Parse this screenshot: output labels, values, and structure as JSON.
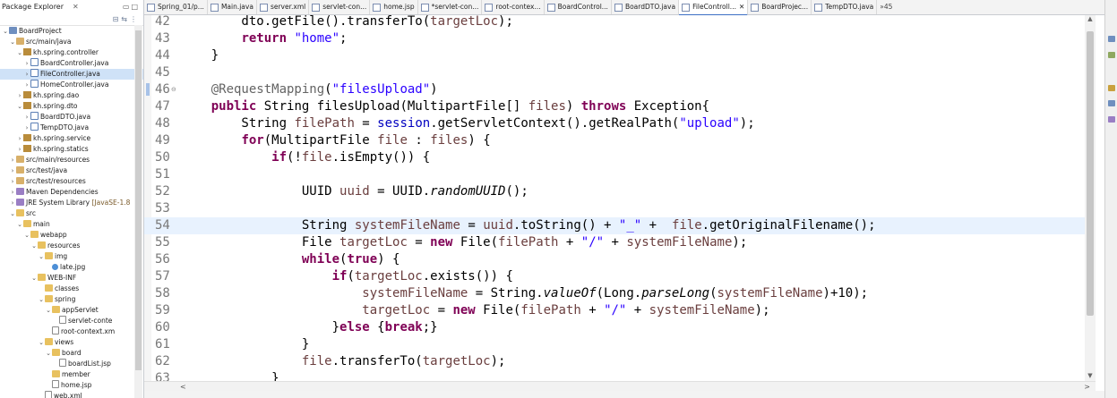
{
  "explorer": {
    "title": "Package Explorer",
    "tree": [
      {
        "depth": 0,
        "twisty": "v",
        "icon": "project",
        "label": "BoardProject"
      },
      {
        "depth": 1,
        "twisty": "v",
        "icon": "srcfolder",
        "label": "src/main/java"
      },
      {
        "depth": 2,
        "twisty": "v",
        "icon": "package",
        "label": "kh.spring.controller"
      },
      {
        "depth": 3,
        "twisty": ">",
        "icon": "java",
        "label": "BoardController.java"
      },
      {
        "depth": 3,
        "twisty": ">",
        "icon": "java",
        "label": "FileController.java",
        "selected": true
      },
      {
        "depth": 3,
        "twisty": ">",
        "icon": "java",
        "label": "HomeController.java"
      },
      {
        "depth": 2,
        "twisty": ">",
        "icon": "package",
        "label": "kh.spring.dao"
      },
      {
        "depth": 2,
        "twisty": "v",
        "icon": "package",
        "label": "kh.spring.dto"
      },
      {
        "depth": 3,
        "twisty": ">",
        "icon": "java",
        "label": "BoardDTO.java"
      },
      {
        "depth": 3,
        "twisty": ">",
        "icon": "java",
        "label": "TempDTO.java"
      },
      {
        "depth": 2,
        "twisty": ">",
        "icon": "package",
        "label": "kh.spring.service"
      },
      {
        "depth": 2,
        "twisty": ">",
        "icon": "package",
        "label": "kh.spring.statics"
      },
      {
        "depth": 1,
        "twisty": ">",
        "icon": "srcfolder",
        "label": "src/main/resources"
      },
      {
        "depth": 1,
        "twisty": ">",
        "icon": "srcfolder",
        "label": "src/test/java"
      },
      {
        "depth": 1,
        "twisty": ">",
        "icon": "srcfolder",
        "label": "src/test/resources"
      },
      {
        "depth": 1,
        "twisty": ">",
        "icon": "lib",
        "label": "Maven Dependencies"
      },
      {
        "depth": 1,
        "twisty": ">",
        "icon": "lib",
        "label": "JRE System Library",
        "decoration": "[JavaSE-1.8"
      },
      {
        "depth": 1,
        "twisty": "v",
        "icon": "folder",
        "label": "src"
      },
      {
        "depth": 2,
        "twisty": "v",
        "icon": "folder",
        "label": "main"
      },
      {
        "depth": 3,
        "twisty": "v",
        "icon": "folder",
        "label": "webapp"
      },
      {
        "depth": 4,
        "twisty": "v",
        "icon": "folder",
        "label": "resources"
      },
      {
        "depth": 5,
        "twisty": "v",
        "icon": "folder",
        "label": "img"
      },
      {
        "depth": 6,
        "twisty": "",
        "icon": "image",
        "label": "late.jpg"
      },
      {
        "depth": 4,
        "twisty": "v",
        "icon": "folder",
        "label": "WEB-INF"
      },
      {
        "depth": 5,
        "twisty": "",
        "icon": "folder",
        "label": "classes"
      },
      {
        "depth": 5,
        "twisty": "v",
        "icon": "folder",
        "label": "spring"
      },
      {
        "depth": 6,
        "twisty": "v",
        "icon": "folder",
        "label": "appServlet"
      },
      {
        "depth": 7,
        "twisty": "",
        "icon": "file",
        "label": "servlet-conte"
      },
      {
        "depth": 6,
        "twisty": "",
        "icon": "file",
        "label": "root-context.xm"
      },
      {
        "depth": 5,
        "twisty": "v",
        "icon": "folder",
        "label": "views"
      },
      {
        "depth": 6,
        "twisty": "v",
        "icon": "folder",
        "label": "board"
      },
      {
        "depth": 7,
        "twisty": "",
        "icon": "file",
        "label": "boardList.jsp"
      },
      {
        "depth": 6,
        "twisty": "",
        "icon": "folder",
        "label": "member"
      },
      {
        "depth": 6,
        "twisty": "",
        "icon": "file",
        "label": "home.jsp"
      },
      {
        "depth": 5,
        "twisty": "",
        "icon": "file",
        "label": "web.xml"
      }
    ]
  },
  "tabs": [
    {
      "label": "Spring_01/p...",
      "active": false
    },
    {
      "label": "Main.java",
      "active": false
    },
    {
      "label": "server.xml",
      "active": false
    },
    {
      "label": "servlet-con...",
      "active": false
    },
    {
      "label": "home.jsp",
      "active": false
    },
    {
      "label": "*servlet-con...",
      "active": false
    },
    {
      "label": "root-contex...",
      "active": false
    },
    {
      "label": "BoardControl...",
      "active": false
    },
    {
      "label": "BoardDTO.java",
      "active": false
    },
    {
      "label": "FileControll...",
      "active": true
    },
    {
      "label": "BoardProjec...",
      "active": false
    },
    {
      "label": "TempDTO.java",
      "active": false
    }
  ],
  "tab_overflow": "»45",
  "editor": {
    "current_line": 54,
    "lines": [
      {
        "n": "42",
        "fold": "",
        "segs": [
          {
            "t": "        dto.getFile().transferTo("
          },
          {
            "t": "targetLoc",
            "c": "var"
          },
          {
            "t": ");"
          }
        ]
      },
      {
        "n": "43",
        "fold": "",
        "segs": [
          {
            "t": "        "
          },
          {
            "t": "return",
            "c": "kw"
          },
          {
            "t": " "
          },
          {
            "t": "\"home\"",
            "c": "str"
          },
          {
            "t": ";"
          }
        ]
      },
      {
        "n": "44",
        "fold": "",
        "segs": [
          {
            "t": "    }"
          }
        ]
      },
      {
        "n": "45",
        "fold": "",
        "segs": [
          {
            "t": ""
          }
        ]
      },
      {
        "n": "46",
        "fold": "⊖",
        "segs": [
          {
            "t": "    "
          },
          {
            "t": "@RequestMapping",
            "c": "ann"
          },
          {
            "t": "("
          },
          {
            "t": "\"filesUpload\"",
            "c": "str"
          },
          {
            "t": ")"
          }
        ]
      },
      {
        "n": "47",
        "fold": "",
        "segs": [
          {
            "t": "    "
          },
          {
            "t": "public",
            "c": "kw"
          },
          {
            "t": " String filesUpload(MultipartFile[] "
          },
          {
            "t": "files",
            "c": "var"
          },
          {
            "t": ") "
          },
          {
            "t": "throws",
            "c": "kw"
          },
          {
            "t": " Exception{"
          }
        ]
      },
      {
        "n": "48",
        "fold": "",
        "segs": [
          {
            "t": "        String "
          },
          {
            "t": "filePath",
            "c": "var"
          },
          {
            "t": " = "
          },
          {
            "t": "session",
            "c": "fld"
          },
          {
            "t": ".getServletContext().getRealPath("
          },
          {
            "t": "\"upload\"",
            "c": "str"
          },
          {
            "t": ");"
          }
        ]
      },
      {
        "n": "49",
        "fold": "",
        "segs": [
          {
            "t": "        "
          },
          {
            "t": "for",
            "c": "kw"
          },
          {
            "t": "(MultipartFile "
          },
          {
            "t": "file",
            "c": "var"
          },
          {
            "t": " : "
          },
          {
            "t": "files",
            "c": "var"
          },
          {
            "t": ") {"
          }
        ]
      },
      {
        "n": "50",
        "fold": "",
        "segs": [
          {
            "t": "            "
          },
          {
            "t": "if",
            "c": "kw"
          },
          {
            "t": "(!"
          },
          {
            "t": "file",
            "c": "var"
          },
          {
            "t": ".isEmpty()) {"
          }
        ]
      },
      {
        "n": "51",
        "fold": "",
        "segs": [
          {
            "t": ""
          }
        ]
      },
      {
        "n": "52",
        "fold": "",
        "segs": [
          {
            "t": "                UUID "
          },
          {
            "t": "uuid",
            "c": "var"
          },
          {
            "t": " = UUID."
          },
          {
            "t": "randomUUID",
            "c": "it"
          },
          {
            "t": "();"
          }
        ]
      },
      {
        "n": "53",
        "fold": "",
        "segs": [
          {
            "t": ""
          }
        ]
      },
      {
        "n": "54",
        "fold": "",
        "segs": [
          {
            "t": "                String "
          },
          {
            "t": "systemFileName",
            "c": "var"
          },
          {
            "t": " = "
          },
          {
            "t": "uuid",
            "c": "var"
          },
          {
            "t": ".toString() + "
          },
          {
            "t": "\"_\"",
            "c": "str"
          },
          {
            "t": " +  "
          },
          {
            "t": "file",
            "c": "var"
          },
          {
            "t": ".getOriginalFilename();"
          }
        ]
      },
      {
        "n": "55",
        "fold": "",
        "segs": [
          {
            "t": "                File "
          },
          {
            "t": "targetLoc",
            "c": "var"
          },
          {
            "t": " = "
          },
          {
            "t": "new",
            "c": "kw"
          },
          {
            "t": " File("
          },
          {
            "t": "filePath",
            "c": "var"
          },
          {
            "t": " + "
          },
          {
            "t": "\"/\"",
            "c": "str"
          },
          {
            "t": " + "
          },
          {
            "t": "systemFileName",
            "c": "var"
          },
          {
            "t": ");"
          }
        ]
      },
      {
        "n": "56",
        "fold": "",
        "segs": [
          {
            "t": "                "
          },
          {
            "t": "while",
            "c": "kw"
          },
          {
            "t": "("
          },
          {
            "t": "true",
            "c": "kw"
          },
          {
            "t": ") {"
          }
        ]
      },
      {
        "n": "57",
        "fold": "",
        "segs": [
          {
            "t": "                    "
          },
          {
            "t": "if",
            "c": "kw"
          },
          {
            "t": "("
          },
          {
            "t": "targetLoc",
            "c": "var"
          },
          {
            "t": ".exists()) {"
          }
        ]
      },
      {
        "n": "58",
        "fold": "",
        "segs": [
          {
            "t": "                        "
          },
          {
            "t": "systemFileName",
            "c": "var"
          },
          {
            "t": " = String."
          },
          {
            "t": "valueOf",
            "c": "it"
          },
          {
            "t": "(Long."
          },
          {
            "t": "parseLong",
            "c": "it"
          },
          {
            "t": "("
          },
          {
            "t": "systemFileName",
            "c": "var"
          },
          {
            "t": ")+10);"
          }
        ]
      },
      {
        "n": "59",
        "fold": "",
        "segs": [
          {
            "t": "                        "
          },
          {
            "t": "targetLoc",
            "c": "var"
          },
          {
            "t": " = "
          },
          {
            "t": "new",
            "c": "kw"
          },
          {
            "t": " File("
          },
          {
            "t": "filePath",
            "c": "var"
          },
          {
            "t": " + "
          },
          {
            "t": "\"/\"",
            "c": "str"
          },
          {
            "t": " + "
          },
          {
            "t": "systemFileName",
            "c": "var"
          },
          {
            "t": ");"
          }
        ]
      },
      {
        "n": "60",
        "fold": "",
        "segs": [
          {
            "t": "                    }"
          },
          {
            "t": "else",
            "c": "kw"
          },
          {
            "t": " {"
          },
          {
            "t": "break",
            "c": "kw"
          },
          {
            "t": ";}"
          }
        ]
      },
      {
        "n": "61",
        "fold": "",
        "segs": [
          {
            "t": "                }"
          }
        ]
      },
      {
        "n": "62",
        "fold": "",
        "segs": [
          {
            "t": "                "
          },
          {
            "t": "file",
            "c": "var"
          },
          {
            "t": ".transferTo("
          },
          {
            "t": "targetLoc",
            "c": "var"
          },
          {
            "t": ");"
          }
        ]
      },
      {
        "n": "63",
        "fold": "",
        "segs": [
          {
            "t": "            }"
          }
        ]
      }
    ]
  },
  "colors": {
    "keyword": "#7f0055",
    "string": "#2a00ff",
    "annotation": "#646464",
    "field": "#0000c0",
    "local_variable": "#6a3e3e",
    "current_line": "#e8f2fe",
    "selection": "#cfe2f7"
  }
}
